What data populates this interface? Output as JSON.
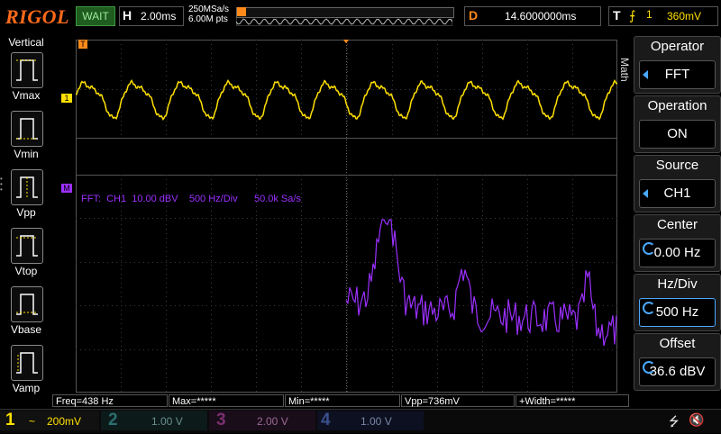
{
  "header": {
    "brand": "RIGOL",
    "status": "WAIT",
    "timebase_label": "H",
    "timebase": "2.00ms",
    "sample_rate": "250MSa/s",
    "memory_depth": "6.00M pts",
    "delay_label": "D",
    "delay": "14.6000000ms",
    "trigger_label": "T",
    "trigger_channel": "1",
    "trigger_level": "360mV"
  },
  "left_panel": {
    "title": "Vertical",
    "measurements": [
      "Vmax",
      "Vmin",
      "Vpp",
      "Vtop",
      "Vbase",
      "Vamp"
    ]
  },
  "screen": {
    "ch1_marker": "1",
    "trigger_marker": "T",
    "math_marker": "M",
    "fft_info": "FFT:  CH1  10.00 dBV    500 Hz/Div      50.0k Sa/s"
  },
  "menu": {
    "tab": "Math",
    "items": [
      {
        "title": "Operator",
        "value": "FFT"
      },
      {
        "title": "Operation",
        "value": "ON"
      },
      {
        "title": "Source",
        "value": "CH1"
      },
      {
        "title": "Center",
        "value": "0.00 Hz"
      },
      {
        "title": "Hz/Div",
        "value": "500 Hz"
      },
      {
        "title": "Offset",
        "value": "36.6 dBV"
      }
    ]
  },
  "measure_bar": {
    "freq": "Freq=438 Hz",
    "max": "Max=*****",
    "min": "Min=*****",
    "vpp": "Vpp=736mV",
    "width": "+Width=*****"
  },
  "channels": [
    {
      "num": "1",
      "coupling": "~",
      "scale": "200mV",
      "color": "#ffe000"
    },
    {
      "num": "2",
      "coupling": "",
      "scale": "1.00 V",
      "color": "#27d3d3"
    },
    {
      "num": "3",
      "coupling": "",
      "scale": "2.00 V",
      "color": "#ff2bd5"
    },
    {
      "num": "4",
      "coupling": "",
      "scale": "1.00 V",
      "color": "#3a7bff"
    }
  ],
  "colors": {
    "ch1": "#ffe000",
    "math": "#9b30ff",
    "trigger": "#ff8a1a",
    "brand": "#ff6a1a",
    "accent": "#4aa8ff"
  }
}
